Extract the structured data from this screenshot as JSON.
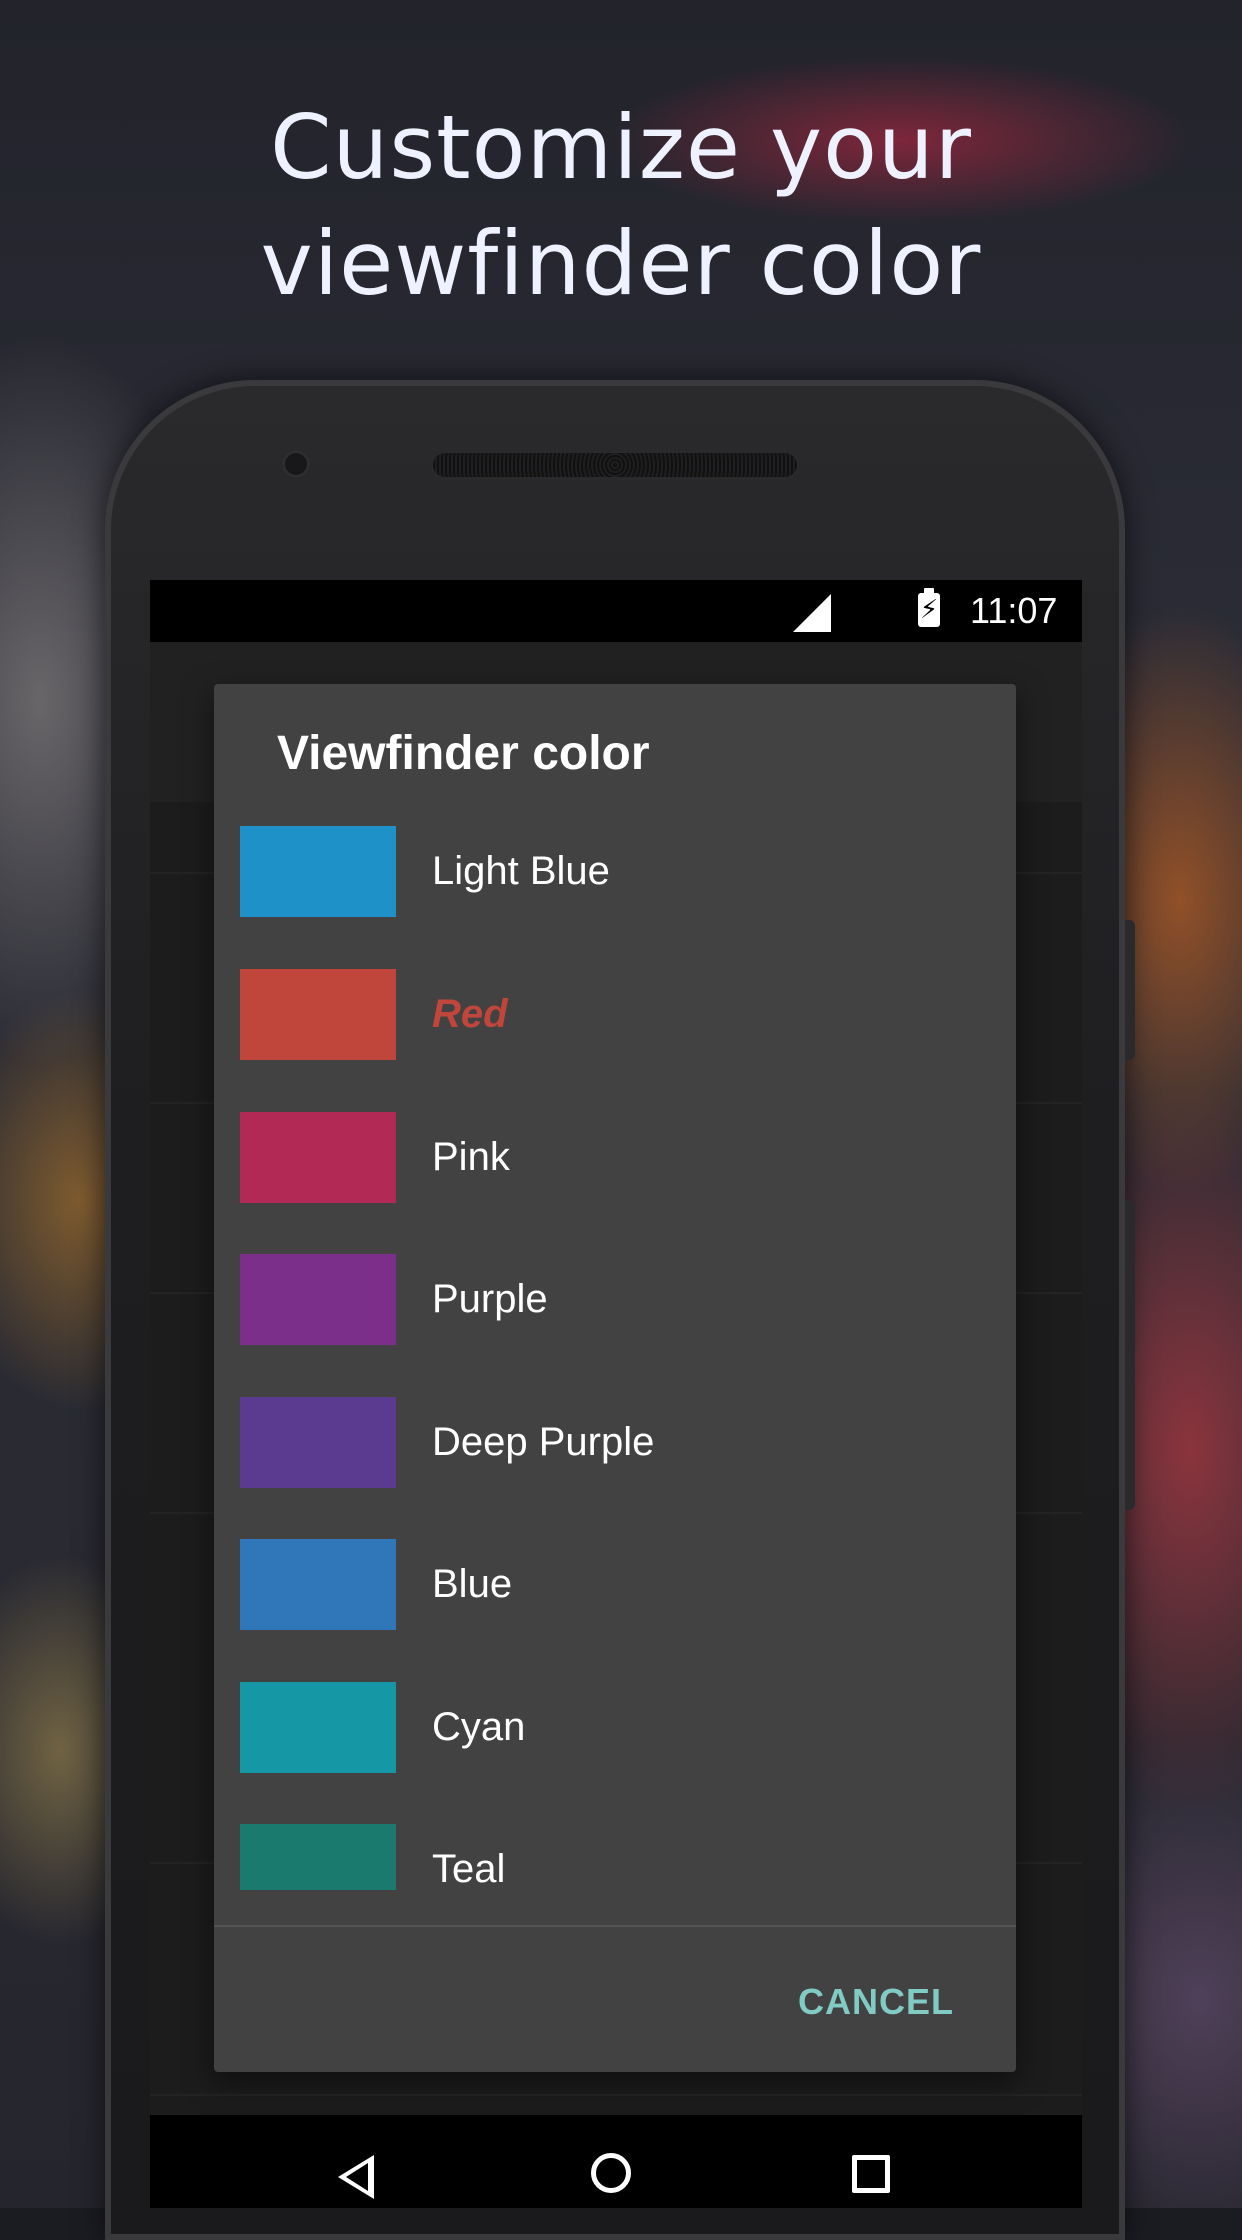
{
  "promo": {
    "headline_line1": "Customize your",
    "headline_line2": "viewfinder color"
  },
  "statusbar": {
    "time": "11:07",
    "battery_glyph": "⚡"
  },
  "dialog": {
    "title": "Viewfinder color",
    "selected": "Red",
    "colors": [
      {
        "label": "Light Blue",
        "hex": "#1f91c9"
      },
      {
        "label": "Red",
        "hex": "#c0453a"
      },
      {
        "label": "Pink",
        "hex": "#b22956"
      },
      {
        "label": "Purple",
        "hex": "#7b2e8a"
      },
      {
        "label": "Deep Purple",
        "hex": "#5a3b8f"
      },
      {
        "label": "Blue",
        "hex": "#2f77b8"
      },
      {
        "label": "Cyan",
        "hex": "#1697a6"
      },
      {
        "label": "Teal",
        "hex": "#1a7a6e"
      }
    ],
    "cancel_label": "CANCEL"
  },
  "colors": {
    "accent": "#80cbc4",
    "selected_text": "#c0453a",
    "dialog_bg": "#424242"
  },
  "icons": {
    "signal": "signal-icon",
    "battery": "battery-charging-icon",
    "back": "back-icon",
    "home": "home-icon",
    "recents": "recents-icon"
  }
}
